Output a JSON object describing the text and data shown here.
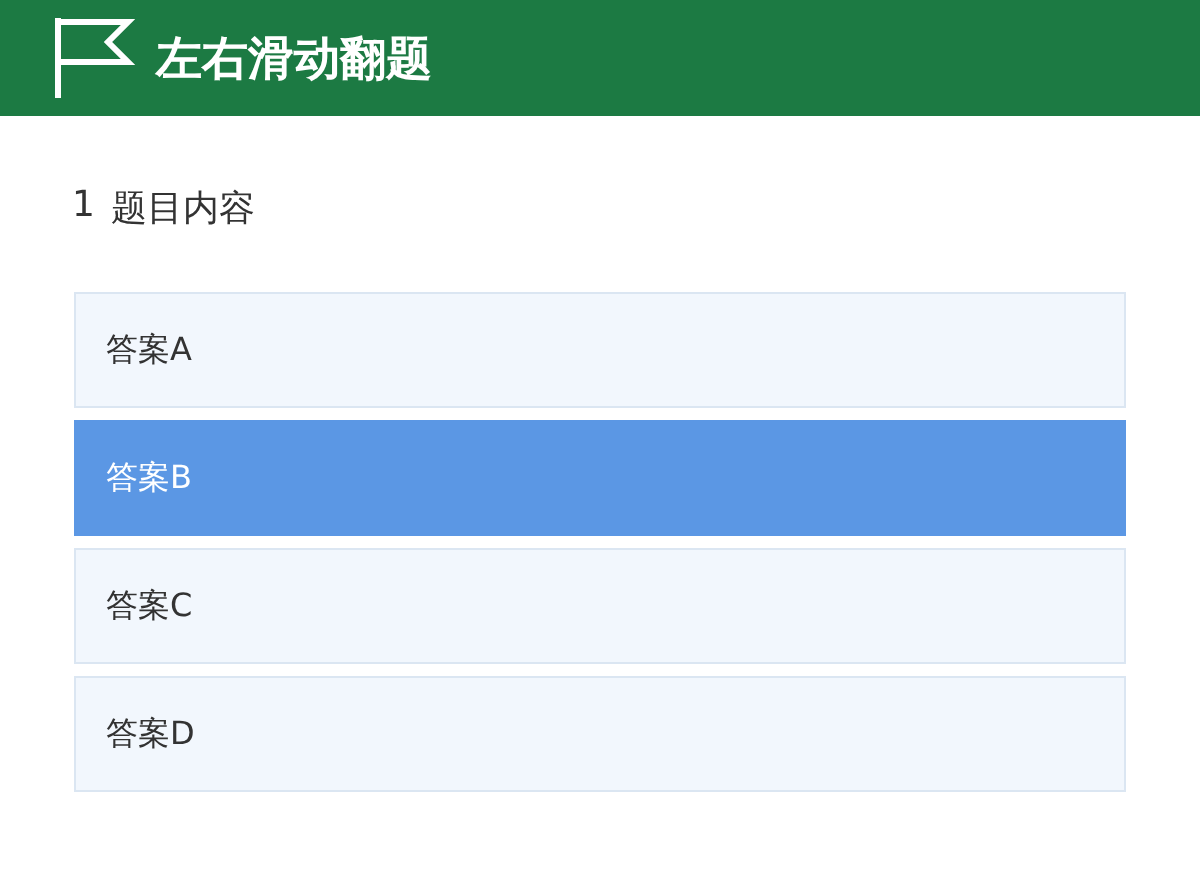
{
  "header": {
    "title": "左右滑动翻题"
  },
  "question": {
    "number": "1",
    "text": "题目内容"
  },
  "options": [
    {
      "label": "答案A",
      "selected": false
    },
    {
      "label": "答案B",
      "selected": true
    },
    {
      "label": "答案C",
      "selected": false
    },
    {
      "label": "答案D",
      "selected": false
    }
  ]
}
